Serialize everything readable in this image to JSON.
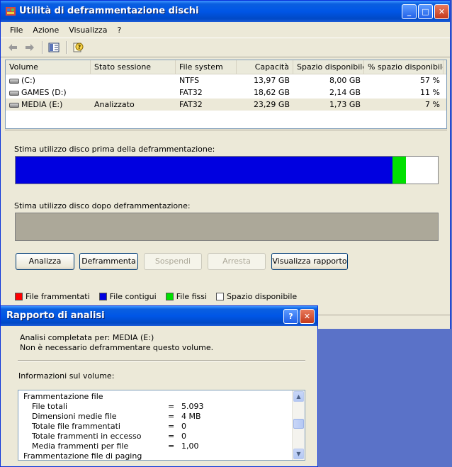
{
  "main_window": {
    "title": "Utilità di deframmentazione dischi",
    "controls": {
      "minimize": "_",
      "maximize": "□",
      "close": "✕"
    }
  },
  "menu": {
    "items": [
      "File",
      "Azione",
      "Visualizza",
      "?"
    ]
  },
  "toolbar": {
    "icons": [
      "back-arrow-icon",
      "forward-arrow-icon",
      "show-hide-pane-icon",
      "help-properties-icon"
    ]
  },
  "volumes": {
    "columns": [
      "Volume",
      "Stato sessione",
      "File system",
      "Capacità",
      "Spazio disponibile",
      "% spazio disponibile"
    ],
    "rows": [
      {
        "volume": "(C:)",
        "status": "",
        "fs": "NTFS",
        "capacity": "13,97 GB",
        "free": "8,00 GB",
        "pct": "57 %"
      },
      {
        "volume": "GAMES (D:)",
        "status": "",
        "fs": "FAT32",
        "capacity": "18,62 GB",
        "free": "2,14 GB",
        "pct": "11 %"
      },
      {
        "volume": "MEDIA (E:)",
        "status": "Analizzato",
        "fs": "FAT32",
        "capacity": "23,29 GB",
        "free": "1,73 GB",
        "pct": "7 %"
      }
    ]
  },
  "analysis": {
    "before_label": "Stima utilizzo disco prima della deframmentazione:",
    "after_label": "Stima utilizzo disco dopo deframmentazione:",
    "before_bar": {
      "contiguous_fraction": 0.893,
      "system_fraction": 0.032,
      "free_fraction": 0.075
    },
    "colors": {
      "fragmented": "#ff0000",
      "contiguous": "#0000e0",
      "system": "#00e000",
      "free": "#ffffff",
      "after_bar": "#aca899"
    }
  },
  "buttons": {
    "analyze": "Analizza",
    "defragment": "Deframmenta",
    "pause": "Sospendi",
    "stop": "Arresta",
    "view_report": "Visualizza rapporto"
  },
  "legend": {
    "fragmented": "File frammentati",
    "contiguous": "File contigui",
    "system": "File fissi",
    "free": "Spazio disponibile"
  },
  "dialog": {
    "title": "Rapporto di analisi",
    "controls": {
      "help": "?",
      "close": "✕"
    },
    "completed": "Analisi completata per: MEDIA (E:)",
    "message": "Non è necessario deframmentare questo volume.",
    "info_label": "Informazioni sul volume:",
    "report_lines": [
      {
        "indent": 0,
        "label": "Frammentazione file",
        "eq": "",
        "value": ""
      },
      {
        "indent": 1,
        "label": "File totali",
        "eq": "=",
        "value": "5.093"
      },
      {
        "indent": 1,
        "label": "Dimensioni medie file",
        "eq": "=",
        "value": "4 MB"
      },
      {
        "indent": 1,
        "label": "Totale file frammentati",
        "eq": "=",
        "value": "0"
      },
      {
        "indent": 1,
        "label": "Totale frammenti in eccesso",
        "eq": "=",
        "value": "0"
      },
      {
        "indent": 1,
        "label": "Media frammenti per file",
        "eq": "=",
        "value": "1,00"
      },
      {
        "indent": 0,
        "label": "Frammentazione file di paging",
        "eq": "",
        "value": ""
      }
    ],
    "scroll_position": 0.45
  }
}
